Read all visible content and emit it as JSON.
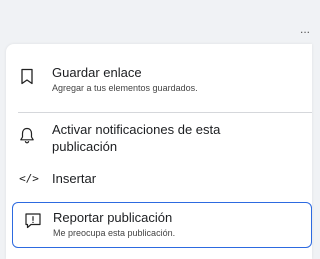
{
  "header": {
    "more_label": "..."
  },
  "menu": {
    "save_link": {
      "title": "Guardar enlace",
      "subtitle": "Agregar a tus elementos guardados.",
      "icon": "bookmark-icon"
    },
    "notifications": {
      "title_line1": "Activar notificaciones de esta",
      "title_line2": "publicación",
      "icon": "bell-icon"
    },
    "embed": {
      "title": "Insertar",
      "icon_glyph": "</>",
      "icon": "code-icon"
    },
    "report": {
      "title": "Reportar publicación",
      "subtitle": "Me preocupa esta publicación.",
      "icon": "report-icon"
    }
  },
  "colors": {
    "focus_ring": "#2d6ae0",
    "background": "#f0f2f5",
    "menu_bg": "#ffffff"
  }
}
